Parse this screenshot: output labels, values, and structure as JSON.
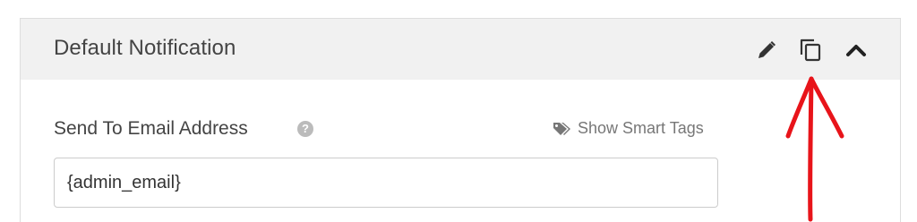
{
  "panel": {
    "title": "Default Notification",
    "actions": {
      "edit_icon": "pencil-icon",
      "clone_icon": "copy-icon",
      "toggle_icon": "chevron-up-icon"
    }
  },
  "field": {
    "label": "Send To Email Address",
    "help_icon": "question-circle-icon",
    "help_glyph": "?",
    "smart_tags_label": "Show Smart Tags",
    "smart_tags_icon": "tags-icon",
    "value": "{admin_email}"
  },
  "colors": {
    "header_bg": "#f1f1f1",
    "text": "#444444",
    "muted": "#777777",
    "annotation": "#e8141a"
  }
}
